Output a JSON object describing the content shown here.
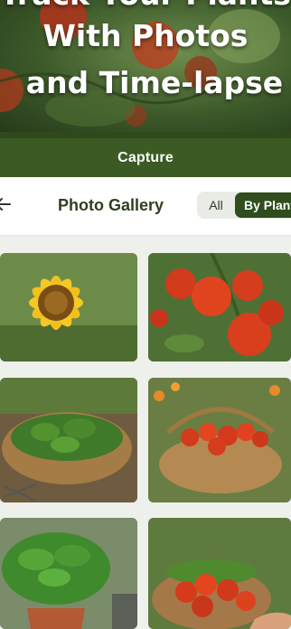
{
  "hero": {
    "line0": "Track Your Plants",
    "line1": "With Photos",
    "line2": "and Time-lapse"
  },
  "capture": {
    "label": "Capture"
  },
  "gallery": {
    "title": "Photo Gallery",
    "filters": {
      "all": "All",
      "by_plant": "By Plant"
    },
    "selected_filter": "By Plant",
    "items": [
      {
        "subject": "sunflower"
      },
      {
        "subject": "tomatoes-on-vine"
      },
      {
        "subject": "basil-in-basket"
      },
      {
        "subject": "cherry-tomatoes-in-basket"
      },
      {
        "subject": "potted-basil"
      },
      {
        "subject": "hand-holding-tomato-basket"
      }
    ]
  },
  "colors": {
    "brand_green": "#3c5a23",
    "active_filter": "#2f4d1d",
    "title_green": "#2f4020"
  }
}
